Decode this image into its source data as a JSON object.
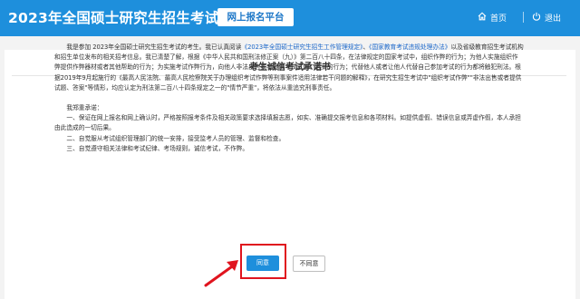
{
  "header": {
    "title": "2023年全国硕士研究生招生考试",
    "subtitle": "网上报名平台",
    "home_label": "首页",
    "logout_label": "退出",
    "home_icon": "home-icon",
    "logout_icon": "power-icon",
    "bg_color": "#1e8fdc"
  },
  "page": {
    "title": "考生诚信考试承诺书",
    "para1_a": "我是参加 2023年全国硕士研究生招生考试的考生。我已认真阅读",
    "link1": "《2023年全国硕士研究生招生工作管理规定》",
    "para1_b": "、",
    "link2": "《国家教育考试违规处理办法》",
    "para1_c": "以及省级教育招生考试机构和招生单位发布的相关招考信息。我已清楚了解，根据《中华人民共和国刑法修正案（九）》第二百八十四条，在法律规定的国家考试中，组织作弊的行为；为他人实施组织作弊提供作弊器材或者其他帮助的行为；为实施考试作弊行为，向他人非法出售或者提供考试试题、答案的行为；代替他人或者让他人代替自己参加考试的行为都将触犯刑法。根据2019年9月起施行的《最高人民法院、最高人民检察院关于办理组织考试作弊等刑事案件适用法律若干问题的解释》，在研究生招生考试中\"组织考试作弊\"\"非法出售或者提供试题、答案\"等情形，均应认定为刑法第二百八十四条规定之一的\"情节严重\"，将依法从重追究刑事责任。",
    "pledge_intro": "我郑重承诺：",
    "pledge1": "一、保证在网上报名和网上确认时，严格按照报考条件及相关政策要求选择填报志愿，如实、准确提交报考信息和各项材料。如提供虚假、错误信息或弄虚作假，本人承担由此造成的一切后果。",
    "pledge2": "二、自觉服从考试组织管理部门的统一安排，接受监考人员的管理、监督和检查。",
    "pledge3": "三、自觉遵守相关法律和考试纪律、考场规则，诚信考试，不作弊。",
    "agree_label": "同意",
    "disagree_label": "不同意",
    "highlight_color": "#e0141e",
    "link_color": "#1a66c9"
  }
}
